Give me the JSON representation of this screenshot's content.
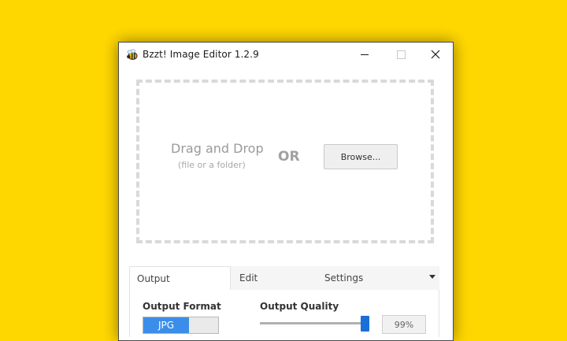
{
  "window": {
    "title": "Bzzt! Image Editor 1.2.9",
    "app_icon": "bee-icon"
  },
  "dropzone": {
    "title": "Drag and Drop",
    "subtitle": "(file or a folder)",
    "or_label": "OR",
    "browse_label": "Browse..."
  },
  "tabs": [
    {
      "label": "Output",
      "active": true
    },
    {
      "label": "Edit",
      "active": false
    },
    {
      "label": "Settings",
      "active": false
    }
  ],
  "output": {
    "format_label": "Output Format",
    "format_selected": "JPG",
    "quality_label": "Output Quality",
    "quality_percent": 99,
    "quality_text": "99%"
  },
  "colors": {
    "background": "#FFD700",
    "accent": "#3a8eea"
  }
}
